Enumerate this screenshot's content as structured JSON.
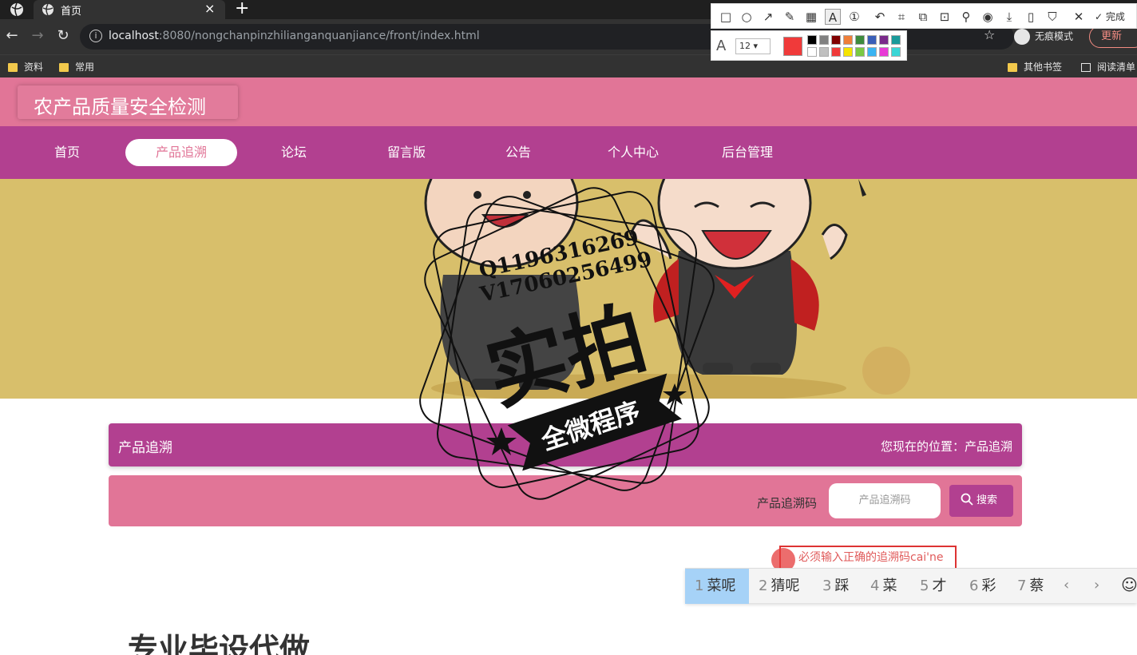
{
  "browser": {
    "tab_title": "首页",
    "url_host": "localhost",
    "url_rest": ":8080/nongchanpinzhilianganquanjiance/front/index.html",
    "incognito_label": "无痕模式",
    "update_label": "更新",
    "bookmarks": [
      "资料",
      "常用"
    ],
    "bookmarks_right": [
      "其他书签",
      "阅读清单"
    ]
  },
  "annotation_toolbar": {
    "done_label": "完成",
    "font_size": "12",
    "current_color": "#f03a3a",
    "palette": [
      "#000000",
      "#808080",
      "#800000",
      "#ef7f3a",
      "#3d8b3d",
      "#3a5fb8",
      "#7a2a8a",
      "#1a9a9a",
      "#ffffff",
      "#c0c0c0",
      "#f03a3a",
      "#f5e400",
      "#7ac943",
      "#3ab4f2",
      "#e83ad6",
      "#3ad6d6"
    ]
  },
  "site": {
    "logo": "农产品质量安全检测",
    "nav": [
      "首页",
      "产品追溯",
      "论坛",
      "留言版",
      "公告",
      "个人中心",
      "后台管理"
    ],
    "active_nav": "产品追溯"
  },
  "watermark": {
    "line1": "Q1196316269",
    "line2": "V17060256499",
    "big": "实拍",
    "ribbon": "全微程序"
  },
  "content": {
    "crumb_title": "产品追溯",
    "crumb_location": "您现在的位置：产品追溯",
    "search_label": "产品追溯码",
    "search_placeholder": "产品追溯码",
    "search_button": "搜索",
    "big_heading": "专业毕设代做"
  },
  "ime": {
    "composing_text": "必须输入正确的追溯码cai'ne",
    "candidates": [
      {
        "num": "1",
        "text": "菜呢"
      },
      {
        "num": "2",
        "text": "猜呢"
      },
      {
        "num": "3",
        "text": "踩"
      },
      {
        "num": "4",
        "text": "菜"
      },
      {
        "num": "5",
        "text": "才"
      },
      {
        "num": "6",
        "text": "彩"
      },
      {
        "num": "7",
        "text": "蔡"
      }
    ],
    "prev": "‹",
    "next": "›",
    "emoji": "☺"
  },
  "colors": {
    "header_pink": "#e17597",
    "nav_purple": "#b24090",
    "banner_bg": "#d8bf6b"
  }
}
